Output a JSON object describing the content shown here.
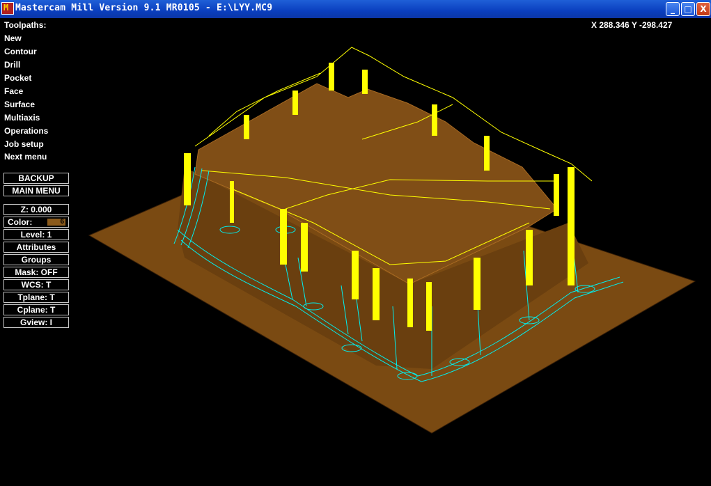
{
  "window": {
    "title": "Mastercam Mill Version 9.1 MR0105 - E:\\LYY.MC9",
    "buttons": {
      "minimize": "_",
      "maximize": "□",
      "close": "X"
    }
  },
  "coords": "X 288.346  Y -298.427",
  "menu": {
    "title": "Toolpaths:",
    "items": [
      "New",
      "Contour",
      "Drill",
      "Pocket",
      "Face",
      "Surface",
      "Multiaxis",
      "Operations",
      "Job setup",
      "Next menu"
    ]
  },
  "nav": {
    "backup": "BACKUP",
    "main_menu": "MAIN MENU"
  },
  "status": {
    "z": "Z:  0.000",
    "color": "Color:",
    "color_value": "6",
    "level": "Level:  1",
    "attributes": "Attributes",
    "groups": "Groups",
    "mask": "Mask:  OFF",
    "wcs": "WCS:  T",
    "tplane": "Tplane:  T",
    "cplane": "Cplane:  T",
    "gview": "Gview:  I"
  },
  "colors": {
    "background": "#000000",
    "part": "#7a4a12",
    "toolpath_yellow": "#ffff00",
    "toolpath_cyan": "#00f0f0"
  }
}
